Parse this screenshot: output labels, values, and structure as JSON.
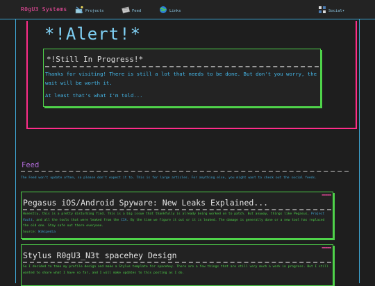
{
  "header": {
    "site_title": "R0gU3 Systems",
    "nav": [
      {
        "label": "Projects",
        "icon": "projects-icon"
      },
      {
        "label": "Feed",
        "icon": "feed-icon"
      },
      {
        "label": "Links",
        "icon": "links-icon"
      },
      {
        "label": "Social▾",
        "icon": "social-icon"
      }
    ]
  },
  "alert": {
    "title": "*!Alert!*",
    "card_title": "*!Still In Progress!*",
    "paragraph_1": "Thanks for visiting! There is still a lot that needs to be done. But don't you worry, the wait will be worth it.",
    "paragraph_2": "At least that's what I'm told..."
  },
  "feed": {
    "heading": "Feed",
    "description": "The Feed won't update often, so please don't expect it to. This is for large articles. For anything else, you might want to check out the social feeds.",
    "posts": [
      {
        "title": "Pegasus iOS/Android Spyware: New Leaks Explained...",
        "body_1": "Honestly, this is a pretty disturbing find. This is a big issue that thankfully is already being worked on to patch. But",
        "body_2": "anyway, things like Pegasus,",
        "body_link_1": "Project Vault",
        "body_3": ", and all the tools that were leaked from the",
        "body_link_2": "CIA",
        "body_4": ". By the time we figure it out or it is leaked. The damage is generally done or a new tool has replaced the old one. Stay safe out there everyone.",
        "source_label": "Source:",
        "source_link": "Wikipedia"
      },
      {
        "title": "Stylus R0gU3_N3t spacehey Design",
        "body_1": "So I decided to take my profile design and make a Stylus template for spacehey. There are a few things that are still very",
        "body_2": "much a work in progress. But I still wanted to share what I have so far, and I will make updates to this posting as I do."
      }
    ]
  },
  "colors": {
    "accent_pink": "#ff2d8a",
    "accent_blue": "#3fa9d8",
    "accent_green": "#4fd34a",
    "feed_purple": "#b06ad8"
  }
}
